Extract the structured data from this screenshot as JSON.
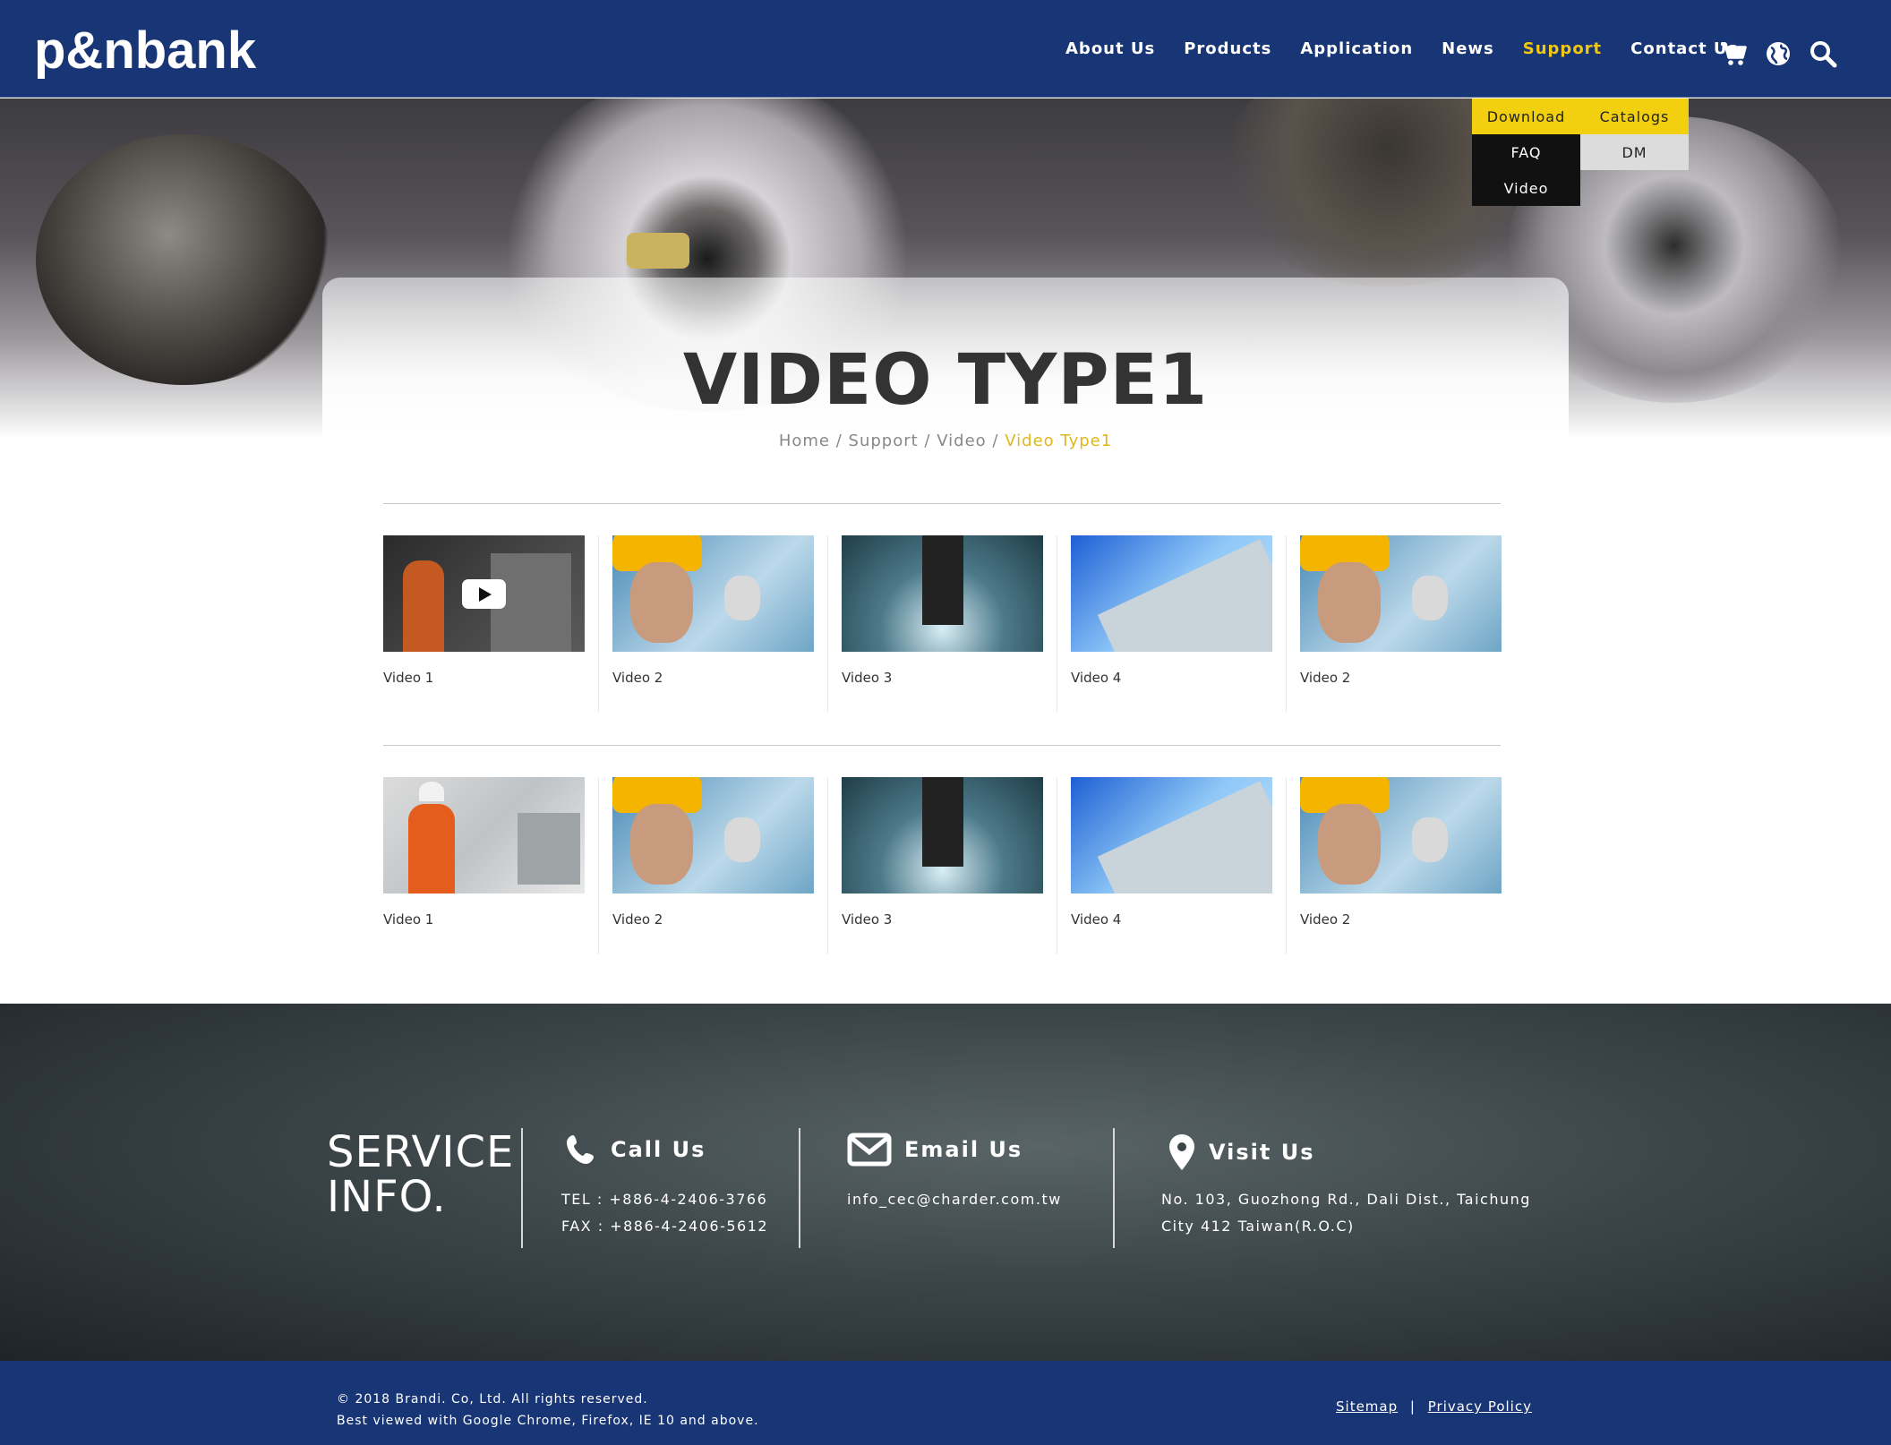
{
  "brand": {
    "logo_text": "p&nbank"
  },
  "nav": {
    "items": [
      "About Us",
      "Products",
      "Application",
      "News",
      "Support",
      "Contact Us"
    ],
    "active": "Support"
  },
  "icons": [
    "cart-icon",
    "globe-icon",
    "search-icon"
  ],
  "submenu": {
    "items": [
      "Download",
      "Catalogs",
      "FAQ",
      "DM",
      "Video"
    ]
  },
  "page": {
    "title": "VIDEO TYPE1"
  },
  "breadcrumb": {
    "items": [
      "Home",
      "Support",
      "Video"
    ],
    "current": "Video Type1",
    "sep": "/"
  },
  "videos": {
    "row1": [
      "Video 1",
      "Video 2",
      "Video 3",
      "Video 4",
      "Video 2"
    ],
    "row2": [
      "Video 1",
      "Video 2",
      "Video 3",
      "Video 4",
      "Video 2"
    ]
  },
  "footer": {
    "service_line1": "SERVICE",
    "service_line2": "INFO.",
    "call_title": "Call Us",
    "tel": "TEL : +886-4-2406-3766",
    "fax": "FAX : +886-4-2406-5612",
    "email_title": "Email Us",
    "email": "info_cec@charder.com.tw",
    "visit_title": "Visit Us",
    "address_line1": "No. 103, Guozhong Rd., Dali Dist., Taichung",
    "address_line2": "City 412 Taiwan(R.O.C)",
    "copyright": "© 2018 Brandi. Co, Ltd. All rights reserved.",
    "browsers": "Best viewed with Google Chrome, Firefox, IE 10 and above.",
    "sitemap": "Sitemap",
    "link_sep": "|",
    "privacy": "Privacy Policy"
  },
  "colors": {
    "primary": "#183575",
    "accent": "#f2c80f",
    "submenu_yellow": "#f2d00f"
  }
}
